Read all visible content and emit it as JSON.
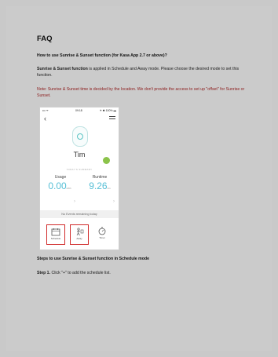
{
  "faq": {
    "title": "FAQ",
    "question": "How to use Sunrise & Sunset function (for Kasa App 2.7 or above)?",
    "intro_bold": "Sunrise & Sunset function",
    "intro_rest": " is applied in Schedule and Away mode. Please choose the desired mode to set this function.",
    "note": "Note: Sunrise & Sunset time is decided by the location. We don't provide the access to set up \"offset\" for Sunrise or Sunset."
  },
  "phone": {
    "status_left": "••• ᯤ",
    "status_time": "09:18",
    "status_right": "✈ ✱ 100% ▬",
    "device_name": "Tim",
    "summary_label": "TODAY'S SUMMARY",
    "usage_label": "Usage",
    "usage_value": "0.00",
    "usage_unit": "kWh",
    "runtime_label": "Runtime",
    "runtime_value": "9.26",
    "runtime_unit": "hrs",
    "chevron": "›",
    "events_text": "No Events remaining today",
    "tabs": [
      {
        "label": "Schedule",
        "icon": "calendar-icon",
        "highlighted": true
      },
      {
        "label": "Away",
        "icon": "away-icon",
        "highlighted": true
      },
      {
        "label": "Timer",
        "icon": "timer-icon",
        "highlighted": false
      }
    ],
    "colors": {
      "accent": "#56bfd6",
      "power": "#8bc34a",
      "highlight": "#d12b2b"
    }
  },
  "steps": {
    "heading": "Steps to use Sunrise & Sunset function in Schedule mode",
    "step1_label": "Step 1.",
    "step1_text": " Click \"+\" to add the schedule list."
  }
}
